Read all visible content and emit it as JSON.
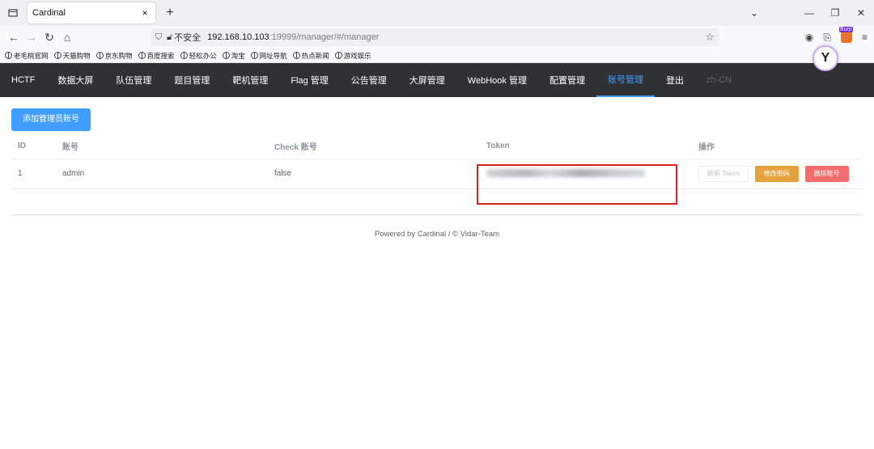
{
  "browser": {
    "tab_title": "Cardinal",
    "tab_close": "×",
    "new_tab": "+",
    "url_insecure": "不安全",
    "url_host": "192.168.10.103",
    "url_path": ":19999/manager/#/manager",
    "bookmarks": [
      "老毛桃官网",
      "天猫购物",
      "京东购物",
      "百度搜索",
      "轻松办公",
      "淘宝",
      "网址导航",
      "热点新闻",
      "游戏娱乐"
    ]
  },
  "nav": {
    "items": [
      "HCTF",
      "数据大屏",
      "队伍管理",
      "题目管理",
      "靶机管理",
      "Flag 管理",
      "公告管理",
      "大屏管理",
      "WebHook 管理",
      "配置管理",
      "账号管理",
      "登出",
      "zh-CN"
    ],
    "active_index": 10
  },
  "page": {
    "add_button": "添加管理员账号",
    "columns": [
      "ID",
      "账号",
      "Check 账号",
      "Token",
      "操作"
    ],
    "rows": [
      {
        "id": "1",
        "account": "admin",
        "check": "false"
      }
    ],
    "actions": {
      "refresh": "刷新 Token",
      "change_password": "修改密码",
      "delete": "删除账号"
    }
  },
  "footer": {
    "text": "Powered by Cardinal / © Vidar-Team"
  },
  "colors": {
    "primary": "#409eff",
    "warning": "#e6a23c",
    "danger": "#f56c6c",
    "navbar": "#303133",
    "highlight": "#e01f1f"
  }
}
